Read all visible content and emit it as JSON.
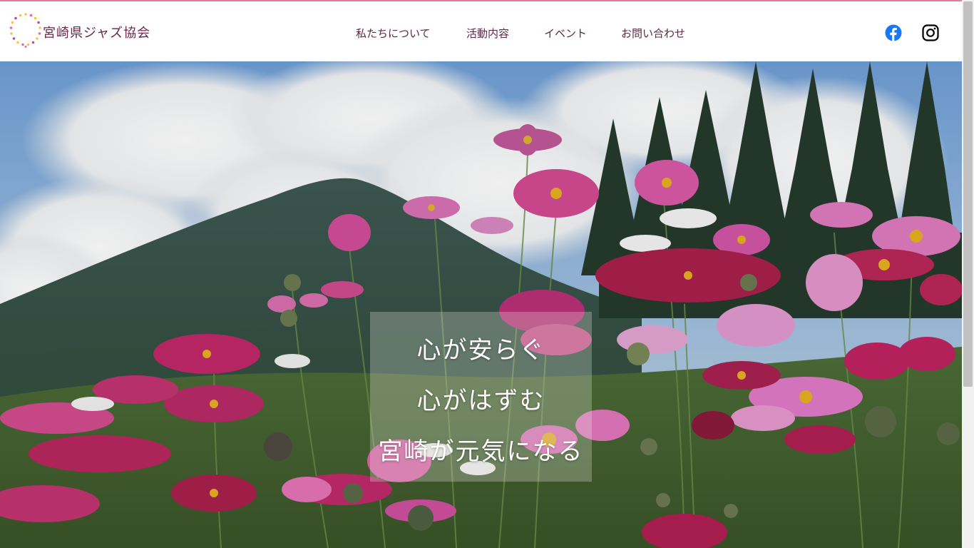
{
  "header": {
    "site_title": "宮崎県ジャズ協会",
    "accent_color": "#e07d9a",
    "nav": [
      {
        "label": "私たちについて"
      },
      {
        "label": "活動内容"
      },
      {
        "label": "イベント"
      },
      {
        "label": "お問い合わせ"
      }
    ],
    "social": [
      {
        "icon": "facebook-icon",
        "color": "#1877f2"
      },
      {
        "icon": "instagram-icon",
        "color": "#000000"
      }
    ]
  },
  "hero": {
    "lines": [
      "心が安らぐ",
      "心がはずむ",
      "宮崎が元気になる"
    ],
    "image": "cosmos-field-mountain-photo"
  }
}
